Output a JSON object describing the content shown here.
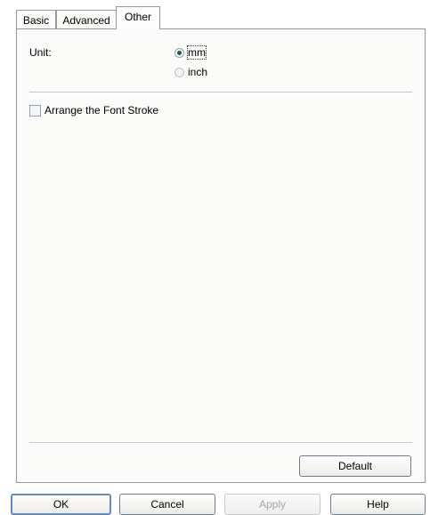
{
  "tabs": [
    {
      "label": "Basic",
      "active": false
    },
    {
      "label": "Advanced",
      "active": false
    },
    {
      "label": "Other",
      "active": true
    }
  ],
  "unit": {
    "label": "Unit:",
    "options": [
      {
        "label": "mm",
        "selected": true
      },
      {
        "label": "inch",
        "selected": false
      }
    ]
  },
  "arrange_font_stroke": {
    "label": "Arrange the Font Stroke",
    "checked": false
  },
  "panel_buttons": {
    "default_label": "Default"
  },
  "footer_buttons": {
    "ok": "OK",
    "cancel": "Cancel",
    "apply": "Apply",
    "help": "Help"
  },
  "colors": {
    "border": "#919b9c",
    "panel_bg": "#fbfbfa",
    "focus_button_border": "#6689c7",
    "disabled_text": "#a5a5a5"
  }
}
